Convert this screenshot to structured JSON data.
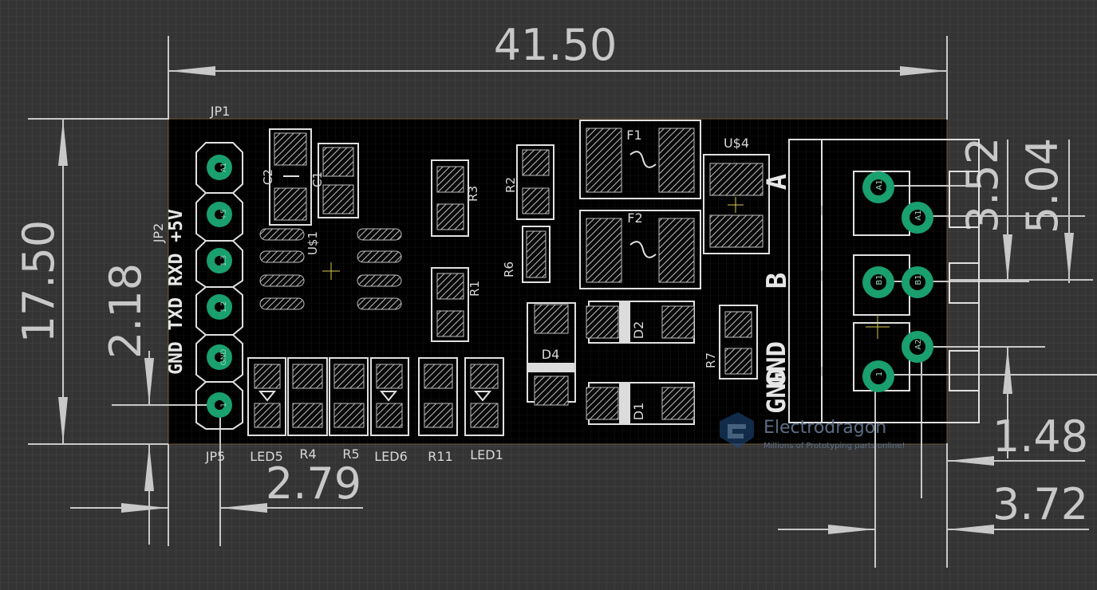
{
  "board": {
    "dimensions": {
      "width": "41.50",
      "height": "17.50",
      "jp5_offset": "2.18",
      "jp5_x": "2.79",
      "term_a": "3.52",
      "term_b": "5.04",
      "term_c": "1.48",
      "term_d": "3.72"
    },
    "refs": {
      "jp1": "JP1",
      "jp2": "JP2",
      "jp5": "JP5",
      "c1": "C1",
      "c2": "C2",
      "r1": "R1",
      "r2": "R2",
      "r3": "R3",
      "r4": "R4",
      "r5": "R5",
      "r6": "R6",
      "r7": "R7",
      "r11": "R11",
      "u1": "U$1",
      "u4": "U$4",
      "f1": "F1",
      "f2": "F2",
      "d1": "D1",
      "d2": "D2",
      "d4": "D4",
      "led1": "LED1",
      "led5": "LED5",
      "led6": "LED6"
    },
    "silkscreen": {
      "header_labels": "GND TXD RXD +5V",
      "a": "A",
      "b": "B",
      "gnd": "GND"
    },
    "pins": {
      "h1": "A1",
      "h2": "+5",
      "h3": "1.3",
      "h4": "1.2",
      "h5": "GND",
      "h6": "1",
      "t1": "A1",
      "t2": "A1",
      "t3": "B1",
      "t4": "B1",
      "t5": "A2",
      "t6": "1"
    },
    "watermark": {
      "name": "Electrodragon",
      "tagline": "Millions of Prototyping parts online!"
    },
    "colors": {
      "background": "#343434",
      "board": "#000000",
      "pad": "#1a9f6f",
      "dimension": "#c8c8c8"
    }
  }
}
